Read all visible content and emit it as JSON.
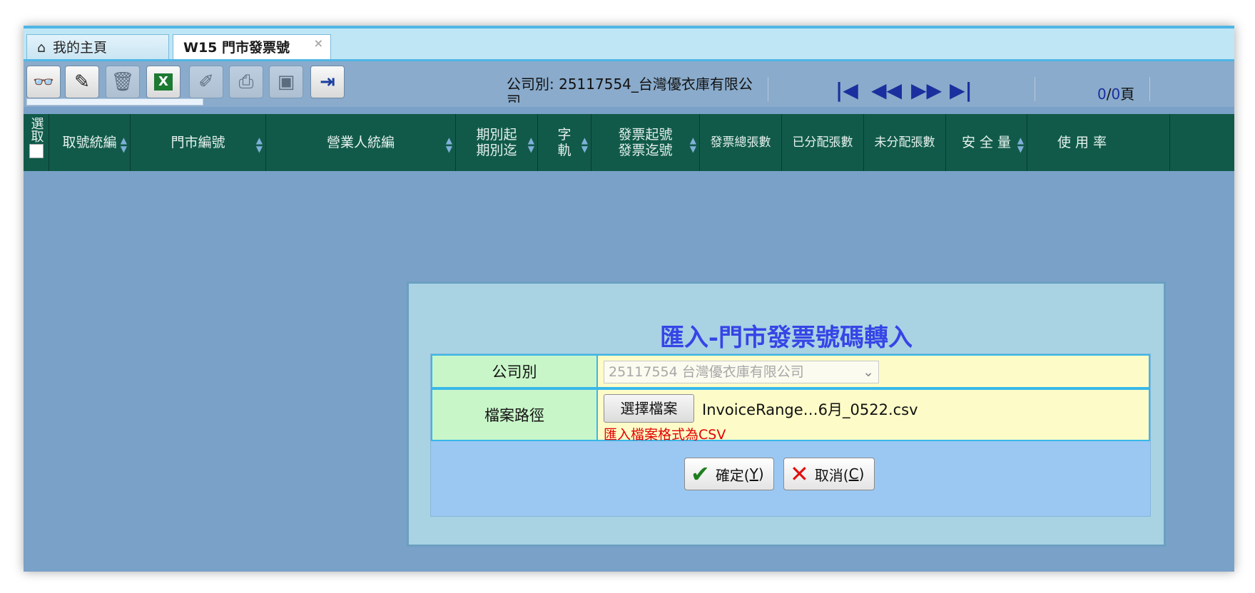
{
  "tabs": [
    {
      "label": "我的主頁",
      "icon": "home-icon",
      "active": false
    },
    {
      "label": "W15 門市發票號",
      "active": true,
      "close": "×"
    }
  ],
  "toolbar": {
    "buttons": [
      {
        "icon": "binoculars-icon",
        "glyph": "🔭",
        "enabled": true
      },
      {
        "icon": "edit-pencil-icon",
        "glyph": "✎",
        "enabled": true
      },
      {
        "icon": "trash-icon",
        "glyph": "🗑",
        "enabled": false
      },
      {
        "icon": "excel-icon",
        "glyph": "X",
        "enabled": true
      },
      {
        "icon": "brush-icon",
        "glyph": "✐",
        "enabled": false
      },
      {
        "icon": "print-icon",
        "glyph": "⎙",
        "enabled": false
      },
      {
        "icon": "export-icon",
        "glyph": "▣",
        "enabled": false
      },
      {
        "icon": "exit-icon",
        "glyph": "⇥",
        "enabled": true
      }
    ],
    "company_label": "公司別: 25117554_台灣優衣庫有限公司",
    "pager": {
      "first": "⏮",
      "prev": "◀◀",
      "next": "▶▶",
      "last": "⏭",
      "current": "0",
      "total": "0",
      "unit": "頁"
    }
  },
  "grid": {
    "select_header": "選取",
    "columns": [
      "取號統編",
      "門市編號",
      "營業人統編",
      "期別起\n期別迄",
      "字\n軌",
      "發票起號\n發票迄號",
      "發票總張數",
      "已分配張數",
      "未分配張數",
      "安 全 量",
      "使 用 率"
    ]
  },
  "dialog": {
    "title": "匯入-門市發票號碼轉入",
    "company_label": "公司別",
    "company_value": "25117554 台灣優衣庫有限公司",
    "file_label": "檔案路徑",
    "file_button": "選擇檔案",
    "file_name": "InvoiceRange…6月_0522.csv",
    "file_hint": "匯入檔案格式為CSV",
    "ok": {
      "text": "確定(",
      "key": "Y",
      "end": ")"
    },
    "cancel": {
      "text": "取消(",
      "key": "C",
      "end": ")"
    }
  }
}
